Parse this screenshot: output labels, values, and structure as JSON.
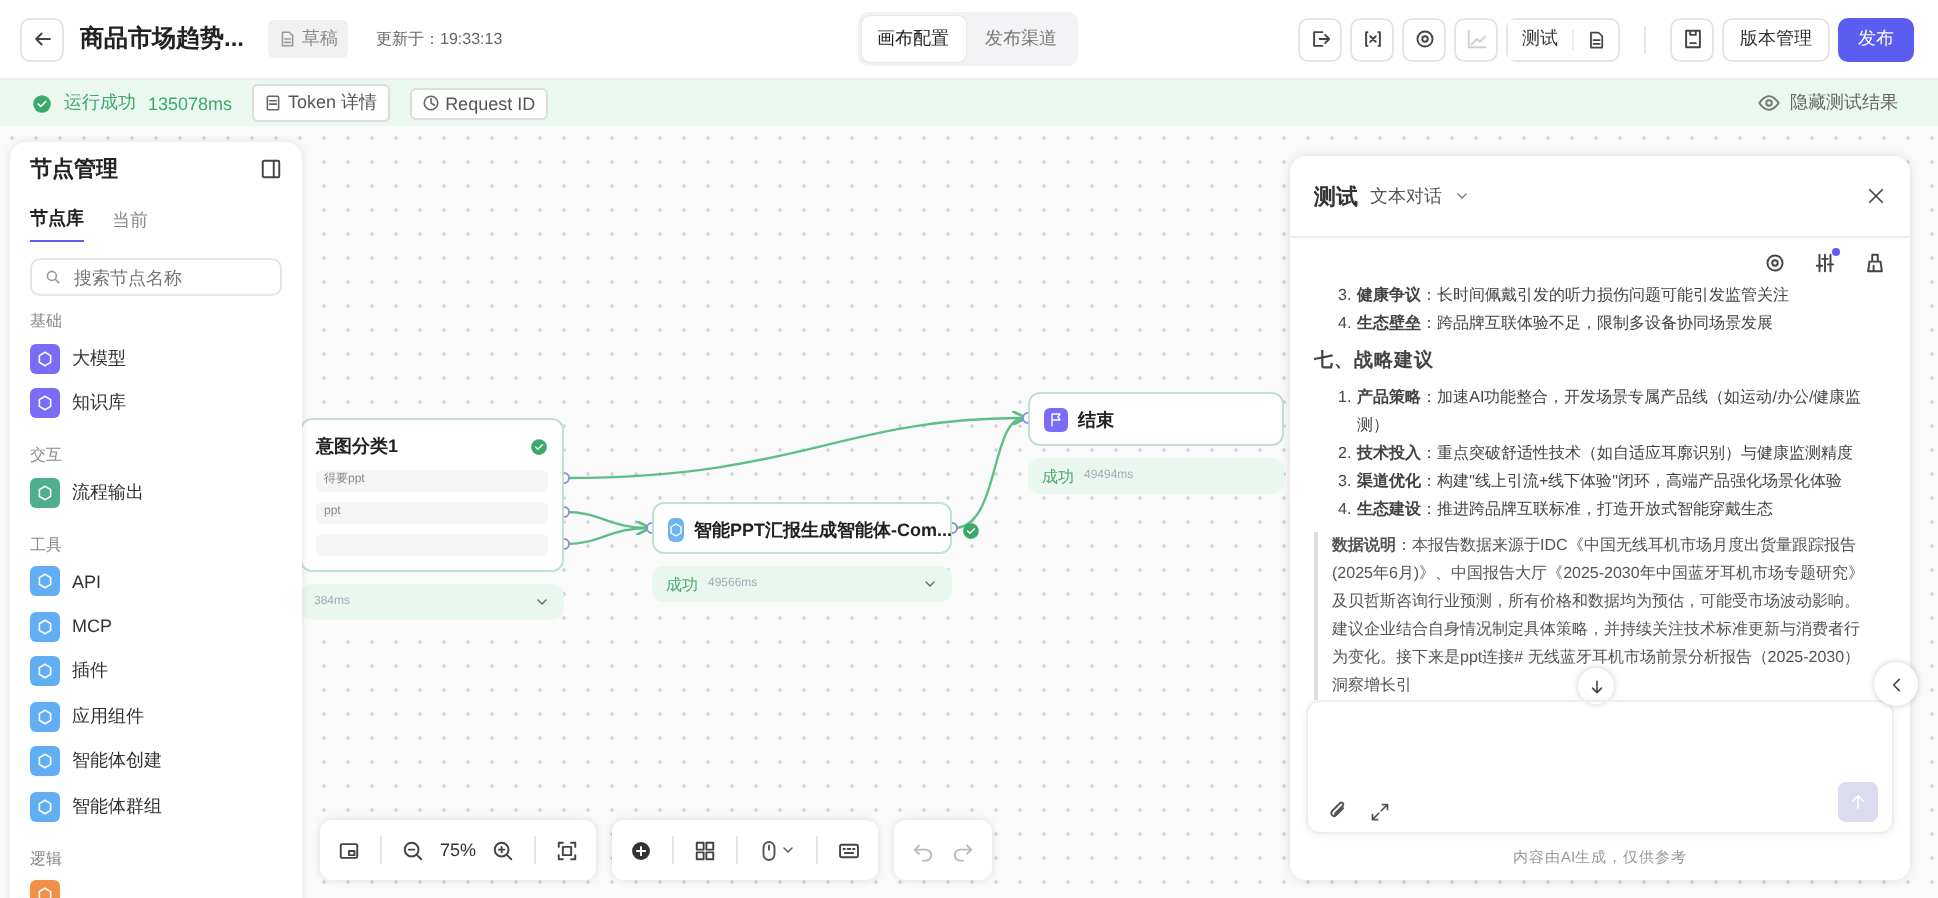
{
  "topbar": {
    "title": "商品市场趋势...",
    "status_badge": "草稿",
    "updated": "更新于：19:33:13",
    "view_tabs": [
      {
        "label": "画布配置",
        "selected": true
      },
      {
        "label": "发布渠道",
        "selected": false
      }
    ],
    "tool_buttons": [
      {
        "kind": "export",
        "disabled": false
      },
      {
        "kind": "variable",
        "disabled": false
      },
      {
        "kind": "settings",
        "disabled": false
      },
      {
        "kind": "chart",
        "disabled": true
      }
    ],
    "test_button": "测试",
    "version_button": "版本管理",
    "publish_button": "发布"
  },
  "run_status": {
    "label": "运行成功",
    "duration": "135078ms",
    "token_button": "Token 详情",
    "request_button": "Request ID",
    "hide_link": "隐藏测试结果"
  },
  "node_panel": {
    "title": "节点管理",
    "tabs": [
      {
        "label": "节点库",
        "selected": true
      },
      {
        "label": "当前",
        "selected": false
      }
    ],
    "search": {
      "placeholder": "搜索节点名称"
    },
    "groups": [
      {
        "name": "基础",
        "items": [
          {
            "label": "大模型",
            "color": "#7a6cf5"
          },
          {
            "label": "知识库",
            "color": "#7a6cf5"
          }
        ]
      },
      {
        "name": "交互",
        "items": [
          {
            "label": "流程输出",
            "color": "#4fae8f"
          }
        ]
      },
      {
        "name": "工具",
        "items": [
          {
            "label": "API",
            "color": "#62aef5"
          },
          {
            "label": "MCP",
            "color": "#62aef5"
          },
          {
            "label": "插件",
            "color": "#62aef5"
          },
          {
            "label": "应用组件",
            "color": "#62aef5"
          },
          {
            "label": "智能体创建",
            "color": "#62aef5"
          },
          {
            "label": "智能体群组",
            "color": "#62aef5"
          }
        ]
      },
      {
        "name": "逻辑",
        "items": [
          {
            "color": "#f0914a"
          }
        ]
      }
    ]
  },
  "canvas": {
    "nodes": [
      {
        "title": "意图分类1",
        "verified": true,
        "options": [
          "得要ppt",
          "ppt"
        ],
        "duration": "384ms",
        "expandable": true
      },
      {
        "title": "智能PPT汇报生成智能体-Com...",
        "verified": true,
        "status": "成功",
        "duration": "49566ms",
        "expandable": true
      },
      {
        "title": "结束",
        "verified": false,
        "status": "成功",
        "duration": "49494ms",
        "expandable": false
      }
    ],
    "toolbar": {
      "zoom": "75%",
      "undo_disabled": true,
      "redo_disabled": true
    }
  },
  "test_panel": {
    "title": "测试",
    "mode": "文本对话",
    "settings_badge": true,
    "content": [
      {
        "kind": "item",
        "number": "3.",
        "text": "**健康争议**：长时间佩戴引发的听力损伤问题可能引发监管关注"
      },
      {
        "kind": "item",
        "number": "4.",
        "text": "**生态壁垒**：跨品牌互联体验不足，限制多设备协同场景发展"
      },
      {
        "kind": "heading",
        "text": "七、战略建议"
      },
      {
        "kind": "item",
        "number": "1.",
        "text": "**产品策略**：加速AI功能整合，开发场景专属产品线（如运动/办公/健康监测）"
      },
      {
        "kind": "item",
        "number": "2.",
        "text": "**技术投入**：重点突破舒适性技术（如自适应耳廓识别）与健康监测精度"
      },
      {
        "kind": "item",
        "number": "3.",
        "text": "**渠道优化**：构建\"线上引流+线下体验\"闭环，高端产品强化场景化体验"
      },
      {
        "kind": "item",
        "number": "4.",
        "text": "**生态建设**：推进跨品牌互联标准，打造开放式智能穿戴生态"
      },
      {
        "kind": "quote",
        "text": "**数据说明**：本报告数据来源于IDC《中国无线耳机市场月度出货量跟踪报告(2025年6月)》、中国报告大厅《2025-2030年中国蓝牙耳机市场专题研究》及贝哲斯咨询行业预测，所有价格和数据均为预估，可能受市场波动影响。建议企业结合自身情况制定具体策略，并持续关注技术标准更新与消费者行为变化。接下来是ppt连接# 无线蓝牙耳机市场前景分析报告（2025-2030）洞察增长引"
      }
    ],
    "send_disabled": true,
    "footer": "内容由AI生成，仅供参考"
  }
}
